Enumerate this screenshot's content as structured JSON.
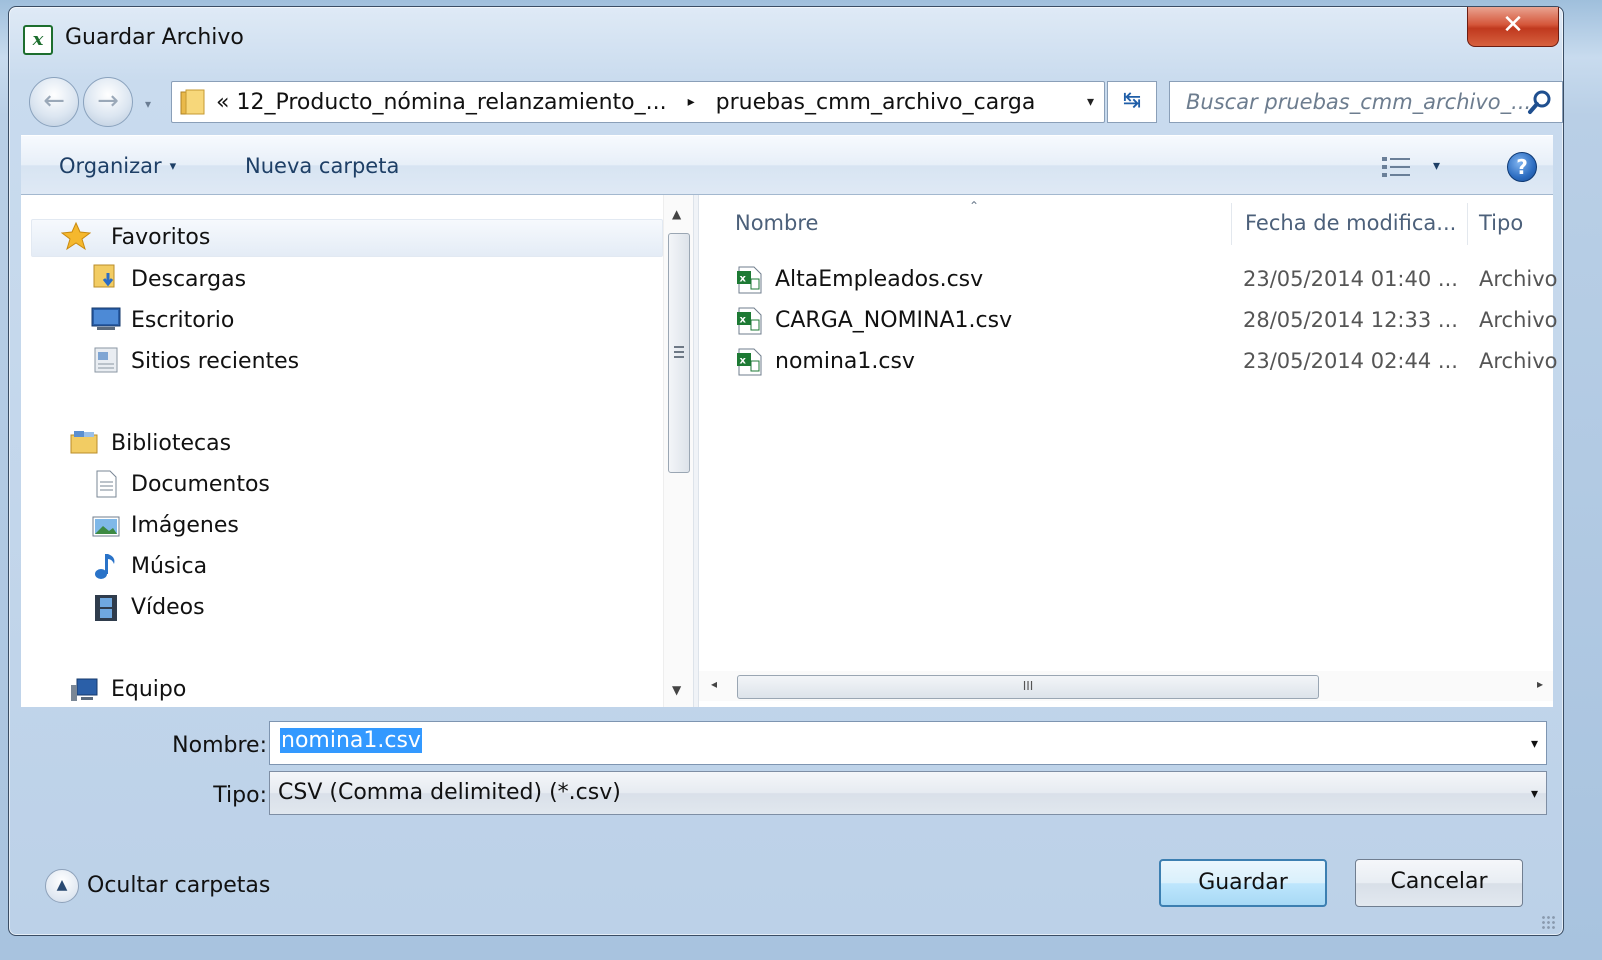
{
  "window": {
    "title": "Guardar Archivo",
    "close_glyph": "✕",
    "app_icon": "excel-icon",
    "app_icon_letter": "x"
  },
  "address": {
    "prefix": "«",
    "segments": [
      "12_Producto_nómina_relanzamiento_...",
      "pruebas_cmm_archivo_carga"
    ],
    "separator": "▸",
    "dropdown_glyph": "▾",
    "refresh_glyph": "↹"
  },
  "search": {
    "placeholder": "Buscar pruebas_cmm_archivo_..."
  },
  "toolbar": {
    "organize_label": "Organizar",
    "organize_arrow": "▾",
    "new_folder_label": "Nueva carpeta",
    "view_arrow": "▾",
    "help_glyph": "?"
  },
  "nav_tree": {
    "favorites": {
      "label": "Favoritos",
      "items": [
        "Descargas",
        "Escritorio",
        "Sitios recientes"
      ]
    },
    "libraries": {
      "label": "Bibliotecas",
      "items": [
        "Documentos",
        "Imágenes",
        "Música",
        "Vídeos"
      ]
    },
    "computer": {
      "label": "Equipo"
    }
  },
  "scroll": {
    "up": "▲",
    "down": "▼",
    "left": "◂",
    "right": "▸",
    "grip": "III"
  },
  "file_list": {
    "columns": [
      "Nombre",
      "Fecha de modifica...",
      "Tipo"
    ],
    "sort_caret": "⌃",
    "rows": [
      {
        "name": "AltaEmpleados.csv",
        "date": "23/05/2014 01:40 ...",
        "type": "Archivo"
      },
      {
        "name": "CARGA_NOMINA1.csv",
        "date": "28/05/2014 12:33 ...",
        "type": "Archivo"
      },
      {
        "name": "nomina1.csv",
        "date": "23/05/2014 02:44 ...",
        "type": "Archivo"
      }
    ]
  },
  "form": {
    "name_label": "Nombre:",
    "name_value": "nomina1.csv",
    "type_label": "Tipo:",
    "type_value": "CSV (Comma delimited) (*.csv)",
    "dropdown_glyph": "▾"
  },
  "footer": {
    "hide_folders_label": "Ocultar carpetas",
    "hide_glyph": "▲",
    "save_label": "Guardar",
    "cancel_label": "Cancelar"
  },
  "colors": {
    "selection": "#3399ff",
    "close_red": "#c0391e",
    "link_blue": "#1e3f66",
    "excel_green": "#1d6e2e"
  }
}
